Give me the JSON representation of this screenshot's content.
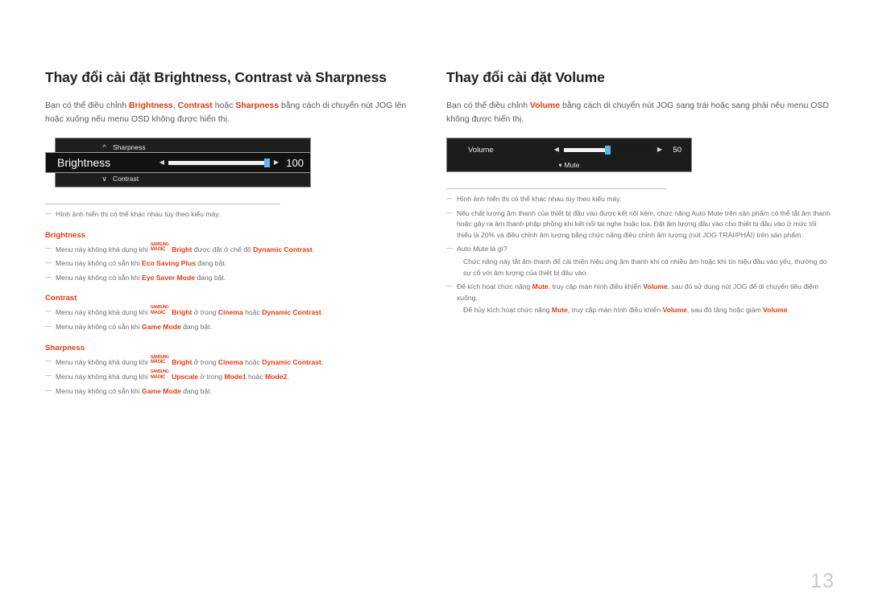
{
  "page": {
    "number": "13"
  },
  "colors": {
    "accent_red": "#e8380d",
    "body_text": "#58595b",
    "title": "#231f20",
    "osd_bg": "#1f1f1f",
    "slider_handle": "#5bb8ef",
    "page_number": "#c9cbcd"
  },
  "left": {
    "title": "Thay đổi cài đặt Brightness, Contrast và Sharpness",
    "intro": {
      "t1": "Bạn có thể điều chỉnh ",
      "k1": "Brightness",
      "t2": ", ",
      "k2": "Contrast",
      "t3": " hoặc ",
      "k3": "Sharpness",
      "t4": " bằng cách di chuyển nút JOG lên hoặc xuống nếu menu OSD không được hiển thị."
    },
    "osd": {
      "row_top_label": "Sharpness",
      "row_top_chevron": "chevron-up-icon",
      "row_mid_label": "Brightness",
      "row_mid_value": "100",
      "row_mid_percent": 100,
      "row_bot_label": "Contrast",
      "row_bot_chevron": "chevron-down-icon",
      "arrow_left": "◀",
      "arrow_right": "▶"
    },
    "note_model": "Hình ảnh hiển thị có thể khác nhau tùy theo kiểu máy.",
    "groups": [
      {
        "heading": "Brightness",
        "notes": [
          {
            "pre": "Menu này không khả dụng khi ",
            "magic": true,
            "mid_kw": "Bright",
            "mid": " được đặt ở chế độ ",
            "kw2": "Dynamic Contrast",
            "post": "."
          },
          {
            "pre": "Menu này không có sẵn khi ",
            "magic": false,
            "kw2": "Eco Saving Plus",
            "post": " đang bật."
          },
          {
            "pre": "Menu này không có sẵn khi ",
            "magic": false,
            "kw2": "Eye Saver Mode",
            "post": " đang bật."
          }
        ]
      },
      {
        "heading": "Contrast",
        "notes": [
          {
            "pre": "Menu này không khả dụng khi ",
            "magic": true,
            "mid_kw": "Bright",
            "mid": " ở trong ",
            "kw2": "Cinema",
            "mid2": " hoặc ",
            "kw3": "Dynamic Contrast",
            "post": "."
          },
          {
            "pre": "Menu này không có sẵn khi ",
            "magic": false,
            "kw2": "Game Mode",
            "post": " đang bật."
          }
        ]
      },
      {
        "heading": "Sharpness",
        "notes": [
          {
            "pre": "Menu này không khả dụng khi ",
            "magic": true,
            "mid_kw": "Bright",
            "mid": " ở trong ",
            "kw2": "Cinema",
            "mid2": " hoặc ",
            "kw3": "Dynamic Contrast",
            "post": "."
          },
          {
            "pre": "Menu này không khả dụng khi ",
            "magic": true,
            "mid_kw": "Upscale",
            "mid": " ở trong ",
            "kw2": "Mode1",
            "mid2": " hoặc ",
            "kw3": "Mode2",
            "post": "."
          },
          {
            "pre": "Menu này không có sẵn khi ",
            "magic": false,
            "kw2": "Game Mode",
            "post": " đang bật."
          }
        ]
      }
    ]
  },
  "right": {
    "title": "Thay đổi cài đặt Volume",
    "intro": {
      "t1": "Bạn có thể điều chỉnh ",
      "k1": "Volume",
      "t2": " bằng cách di chuyển nút JOG sang trái hoặc sang phải nếu menu OSD không được hiển thị."
    },
    "osd": {
      "label": "Volume",
      "value": "50",
      "percent": 50,
      "mute_label": "Mute",
      "mute_chevron": "chevron-down-icon",
      "arrow_left": "◀",
      "arrow_right": "▶"
    },
    "note_model": "Hình ảnh hiển thị có thể khác nhau tùy theo kiểu máy.",
    "note_auto_mute": "Nếu chất lượng âm thanh của thiết bị đầu vào được kết nối kém, chức năng Auto Mute trên sản phẩm có thể tắt âm thanh hoặc gây ra âm thanh phập phồng khi kết nối tai nghe hoặc loa. Đặt âm lượng đầu vào cho thiết bị đầu vào ở mức tối thiểu là 20% và điều chỉnh âm lượng bằng chức năng điều chỉnh âm lượng (nút JOG TRÁI/PHẢI) trên sản phẩm.",
    "note_what_is": "Auto Mute là gì?",
    "note_what_is_body": "Chức năng này tắt âm thanh để cải thiện hiệu ứng âm thanh khi có nhiều âm hoặc khi tín hiệu đầu vào yếu, thường do sự cố với âm lượng của thiết bị đầu vào.",
    "note_activate": {
      "p1": "Để kích hoạt chức năng ",
      "k1": "Mute",
      "p2": ", truy cập màn hình điều khiển ",
      "k2": "Volume",
      "p3": ", sau đó sử dụng nút JOG để di chuyển tiêu điểm xuống."
    },
    "note_deactivate": {
      "p1": "Để hủy kích hoạt chức năng ",
      "k1": "Mute",
      "p2": ", truy cập màn hình điều khiển ",
      "k2": "Volume",
      "p3": ", sau đó tăng hoặc giảm ",
      "k3": "Volume",
      "p4": "."
    }
  },
  "magic_logo": {
    "line1": "SAMSUNG",
    "line2": "MAGIC"
  }
}
